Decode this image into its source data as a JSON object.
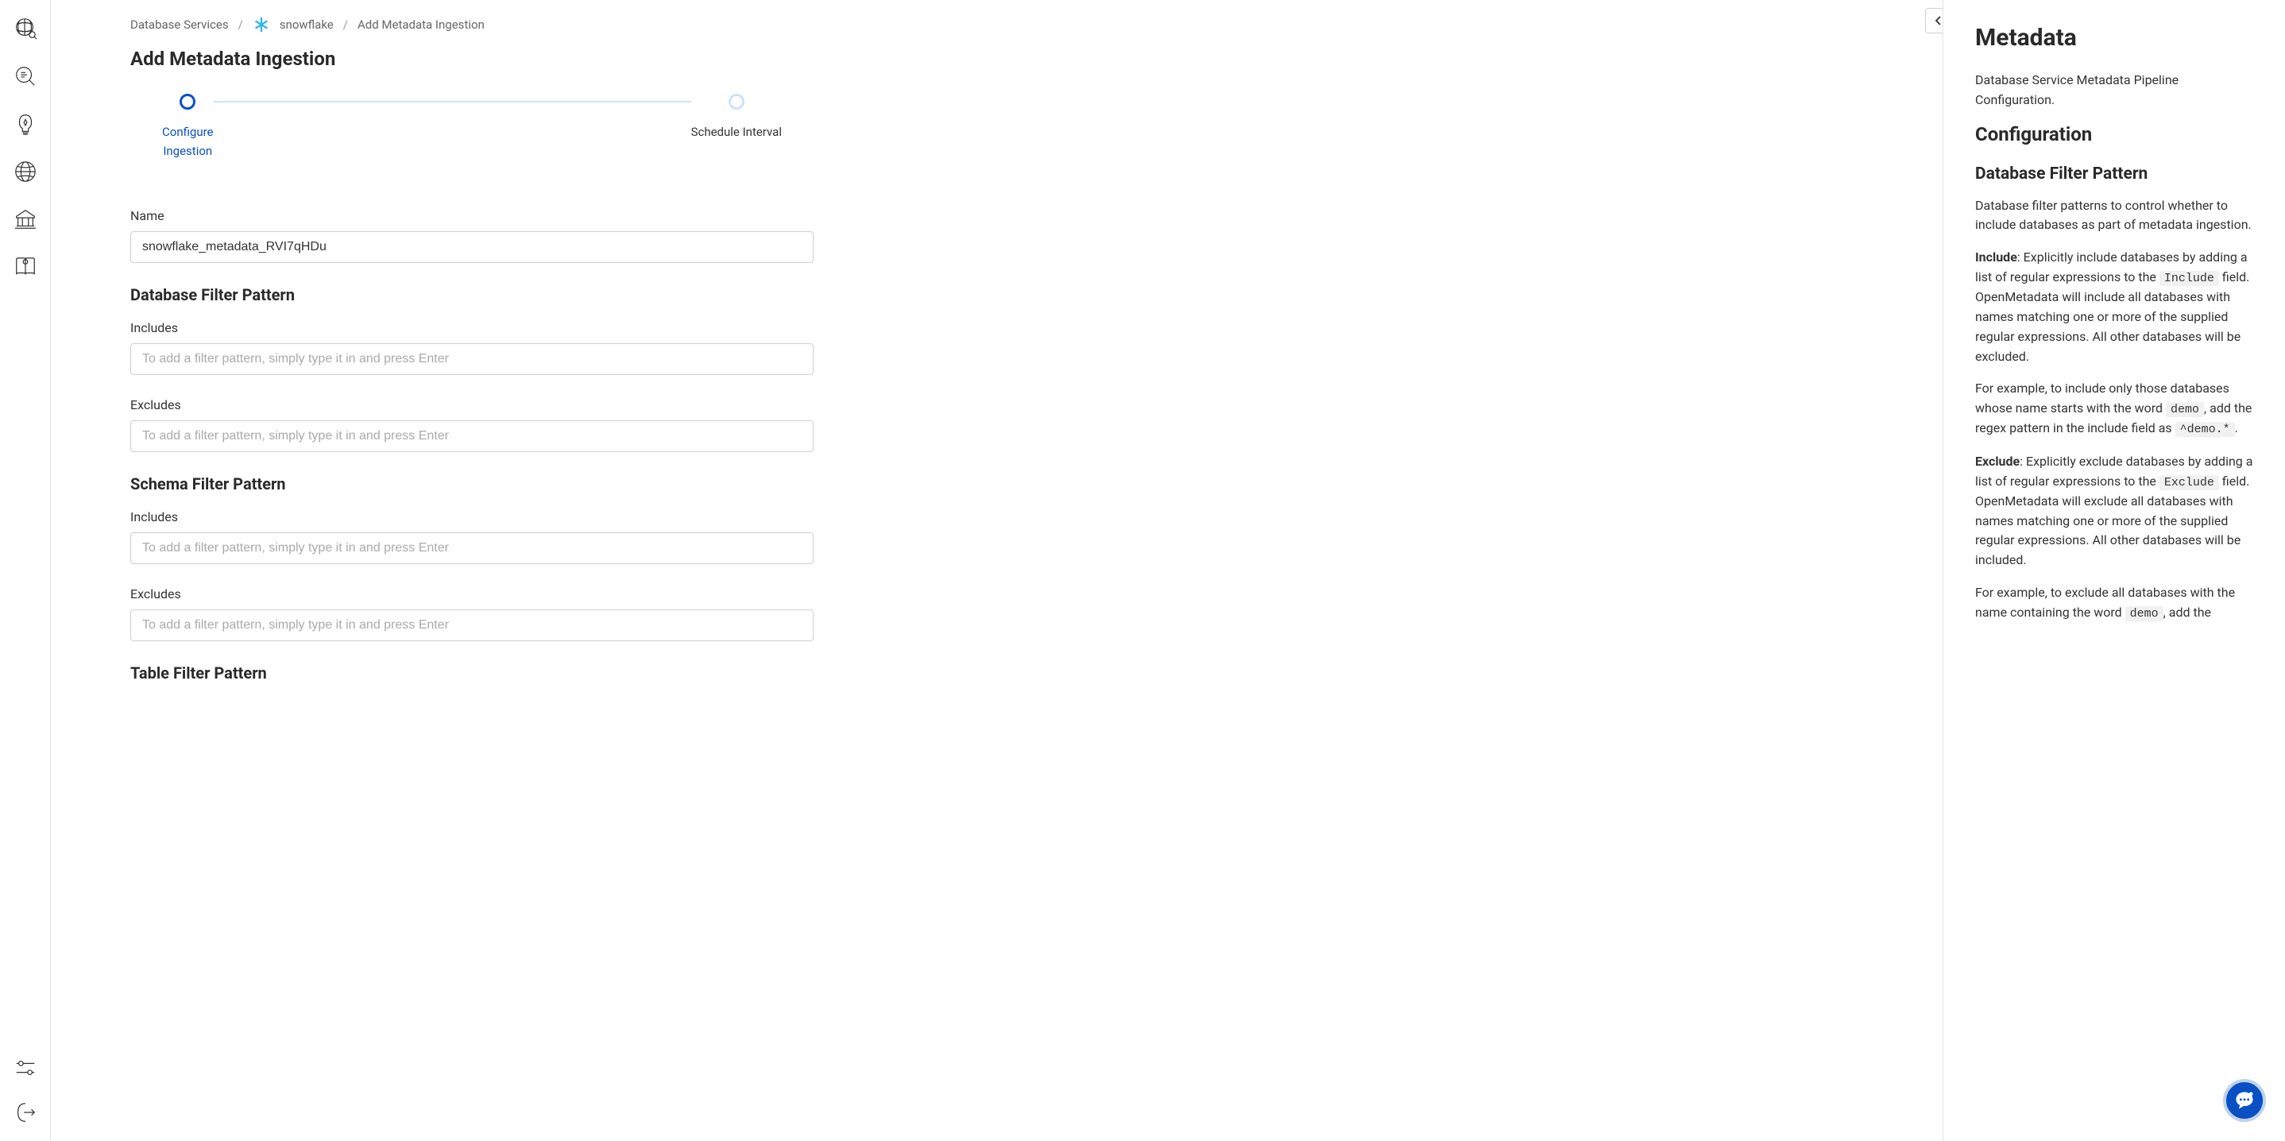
{
  "breadcrumb": {
    "root": "Database Services",
    "service": "snowflake",
    "current": "Add Metadata Ingestion"
  },
  "page_title": "Add Metadata Ingestion",
  "stepper": {
    "step1_line1": "Configure",
    "step1_line2": "Ingestion",
    "step2": "Schedule Interval"
  },
  "form": {
    "name_label": "Name",
    "name_value": "snowflake_metadata_RVI7qHDu",
    "db_filter_title": "Database Filter Pattern",
    "schema_filter_title": "Schema Filter Pattern",
    "table_filter_title": "Table Filter Pattern",
    "includes_label": "Includes",
    "excludes_label": "Excludes",
    "filter_placeholder": "To add a filter pattern, simply type it in and press Enter"
  },
  "help": {
    "title": "Metadata",
    "desc": "Database Service Metadata Pipeline Configuration.",
    "config_title": "Configuration",
    "dbfilter_title": "Database Filter Pattern",
    "dbfilter_desc": "Database filter patterns to control whether to include databases as part of metadata ingestion.",
    "include_bold": "Include",
    "include_p1a": ": Explicitly include databases by adding a list of regular expressions to the ",
    "include_code": "Include",
    "include_p1b": " field. OpenMetadata will include all databases with names matching one or more of the supplied regular expressions. All other databases will be excluded.",
    "include_ex_a": "For example, to include only those databases whose name starts with the word ",
    "include_ex_code1": "demo",
    "include_ex_b": ", add the regex pattern in the include field as ",
    "include_ex_code2": "^demo.*",
    "include_ex_c": ".",
    "exclude_bold": "Exclude",
    "exclude_p1a": ": Explicitly exclude databases by adding a list of regular expressions to the ",
    "exclude_code": "Exclude",
    "exclude_p1b": " field. OpenMetadata will exclude all databases with names matching one or more of the supplied regular expressions. All other databases will be included.",
    "exclude_ex_a": "For example, to exclude all databases with the name containing the word ",
    "exclude_ex_code1": "demo",
    "exclude_ex_b": ", add the"
  }
}
